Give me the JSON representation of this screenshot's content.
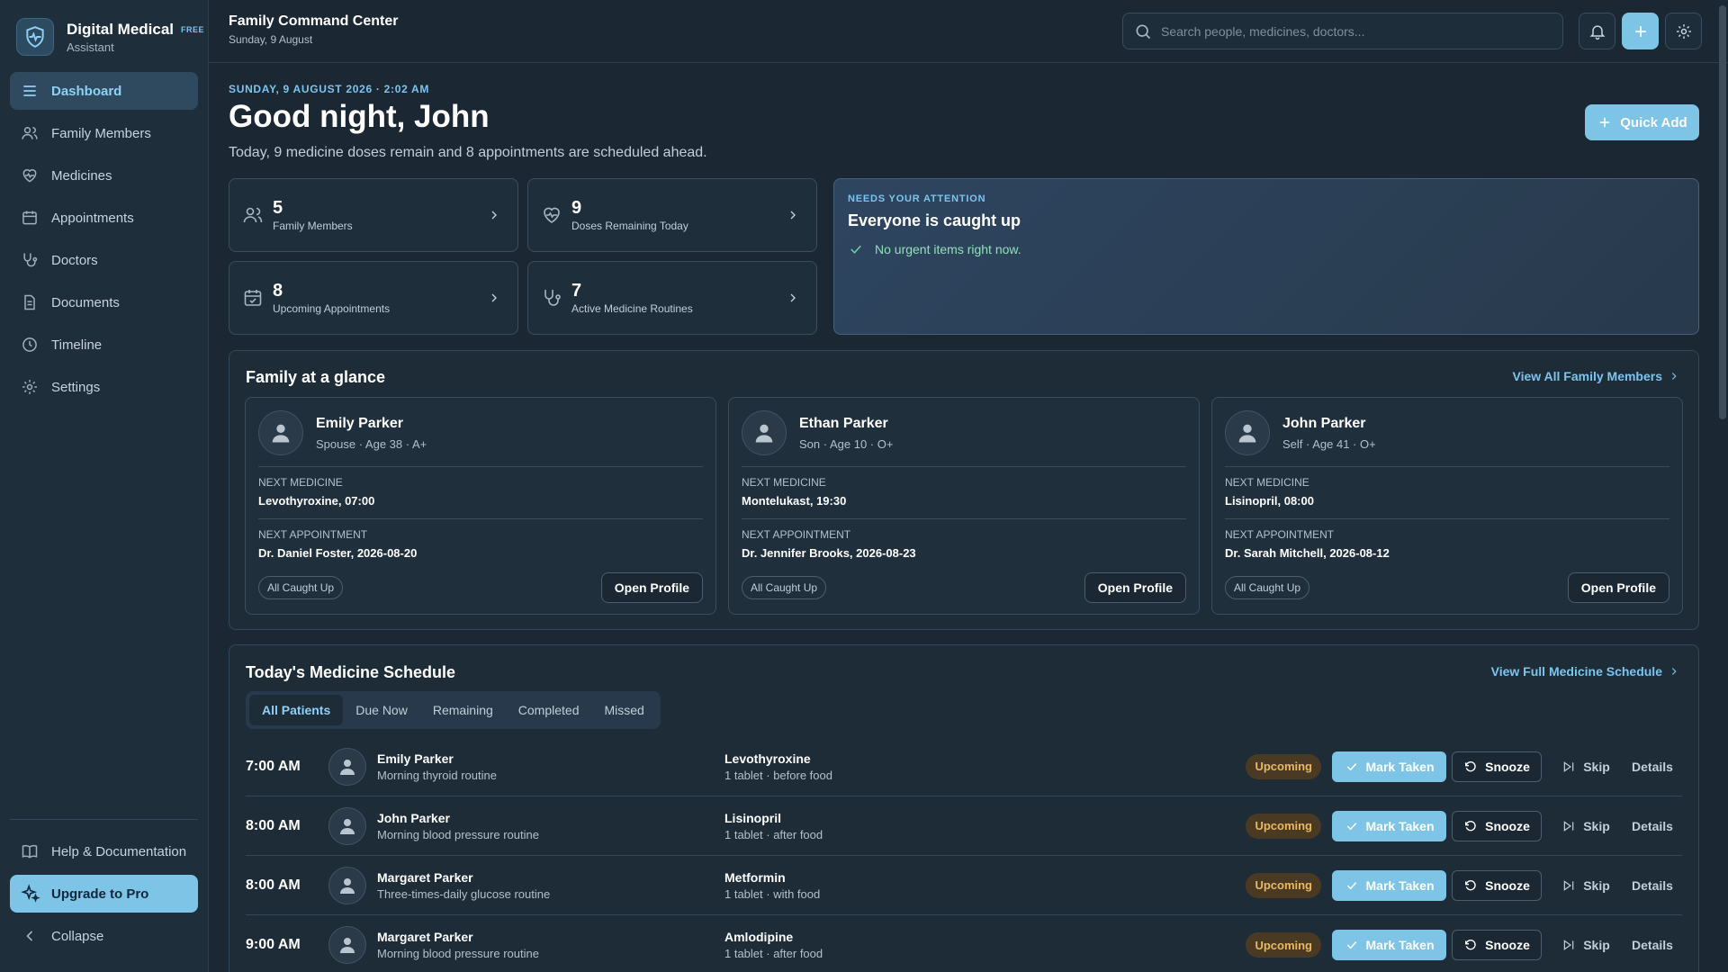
{
  "app": {
    "name": "Digital Medical",
    "badge": "FREE",
    "subtitle": "Assistant"
  },
  "sidebar": {
    "items": [
      {
        "label": "Dashboard",
        "icon": "menu-icon"
      },
      {
        "label": "Family Members",
        "icon": "users-icon"
      },
      {
        "label": "Medicines",
        "icon": "heart-pulse-icon"
      },
      {
        "label": "Appointments",
        "icon": "calendar-icon"
      },
      {
        "label": "Doctors",
        "icon": "stethoscope-icon"
      },
      {
        "label": "Documents",
        "icon": "document-icon"
      },
      {
        "label": "Timeline",
        "icon": "clock-icon"
      },
      {
        "label": "Settings",
        "icon": "gear-icon"
      }
    ],
    "help_label": "Help & Documentation",
    "upgrade_label": "Upgrade to Pro",
    "collapse_label": "Collapse"
  },
  "header": {
    "title": "Family Command Center",
    "date": "Sunday, 9 August",
    "search_placeholder": "Search people, medicines, doctors..."
  },
  "greeting": {
    "datetime": "SUNDAY, 9 AUGUST 2026 · 2:02 AM",
    "title": "Good night, John",
    "summary": "Today, 9 medicine doses remain and 8 appointments are scheduled ahead.",
    "quick_add_label": "Quick Add"
  },
  "stats": [
    {
      "value": "5",
      "label": "Family Members"
    },
    {
      "value": "9",
      "label": "Doses Remaining Today"
    },
    {
      "value": "8",
      "label": "Upcoming Appointments"
    },
    {
      "value": "7",
      "label": "Active Medicine Routines"
    }
  ],
  "attention": {
    "kicker": "NEEDS YOUR ATTENTION",
    "title": "Everyone is caught up",
    "message": "No urgent items right now."
  },
  "family": {
    "title": "Family at a glance",
    "link": "View All Family Members",
    "next_medicine_label": "NEXT MEDICINE",
    "next_appointment_label": "NEXT APPOINTMENT",
    "members": [
      {
        "name": "Emily Parker",
        "meta": "Spouse · Age 38 · A+",
        "medicine": "Levothyroxine, 07:00",
        "appointment": "Dr. Daniel Foster, 2026-08-20",
        "status": "All Caught Up",
        "action": "Open Profile"
      },
      {
        "name": "Ethan Parker",
        "meta": "Son · Age 10 · O+",
        "medicine": "Montelukast, 19:30",
        "appointment": "Dr. Jennifer Brooks, 2026-08-23",
        "status": "All Caught Up",
        "action": "Open Profile"
      },
      {
        "name": "John Parker",
        "meta": "Self · Age 41 · O+",
        "medicine": "Lisinopril, 08:00",
        "appointment": "Dr. Sarah Mitchell, 2026-08-12",
        "status": "All Caught Up",
        "action": "Open Profile"
      }
    ]
  },
  "schedule": {
    "title": "Today's Medicine Schedule",
    "link": "View Full Medicine Schedule",
    "tabs": [
      "All Patients",
      "Due Now",
      "Remaining",
      "Completed",
      "Missed"
    ],
    "active_tab": "All Patients",
    "action_labels": {
      "mark": "Mark Taken",
      "snooze": "Snooze",
      "skip": "Skip",
      "details": "Details"
    },
    "rows": [
      {
        "time": "7:00 AM",
        "patient": "Emily Parker",
        "routine": "Morning thyroid routine",
        "medicine": "Levothyroxine",
        "dose": "1 tablet · before food",
        "status": "Upcoming"
      },
      {
        "time": "8:00 AM",
        "patient": "John Parker",
        "routine": "Morning blood pressure routine",
        "medicine": "Lisinopril",
        "dose": "1 tablet · after food",
        "status": "Upcoming"
      },
      {
        "time": "8:00 AM",
        "patient": "Margaret Parker",
        "routine": "Three-times-daily glucose routine",
        "medicine": "Metformin",
        "dose": "1 tablet · with food",
        "status": "Upcoming"
      },
      {
        "time": "9:00 AM",
        "patient": "Margaret Parker",
        "routine": "Morning blood pressure routine",
        "medicine": "Amlodipine",
        "dose": "1 tablet · after food",
        "status": "Upcoming"
      }
    ]
  },
  "colors": {
    "accent": "#7ec4e6",
    "background": "#1b2733",
    "sidebar": "#1f2e3b",
    "status_upcoming": "#e8b964",
    "success": "#6fd3a2"
  }
}
